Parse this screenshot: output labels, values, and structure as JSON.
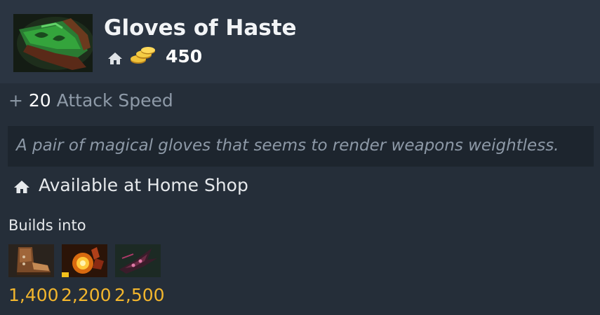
{
  "item": {
    "name": "Gloves of Haste",
    "icon": "gloves-of-haste-icon",
    "cost": "450",
    "cost_icons": [
      "home-shop-icon",
      "gold-coins-icon"
    ]
  },
  "stat": {
    "plus": "+",
    "value": "20",
    "name": "Attack Speed"
  },
  "lore": "A pair of magical gloves that seems to render weapons weightless.",
  "availability": {
    "icon": "home-shop-icon",
    "text": "Available at Home Shop"
  },
  "builds_into": {
    "label": "Builds into",
    "items": [
      {
        "icon": "boots-icon",
        "price": "1,400"
      },
      {
        "icon": "glowing-gauntlet-icon",
        "price": "2,200"
      },
      {
        "icon": "dark-blade-icon",
        "price": "2,500"
      }
    ]
  },
  "colors": {
    "background": "#252e39",
    "header": "#2b3542",
    "lore_box": "#1d252e",
    "gold": "#f2b62d",
    "muted": "#8e9aa8"
  }
}
